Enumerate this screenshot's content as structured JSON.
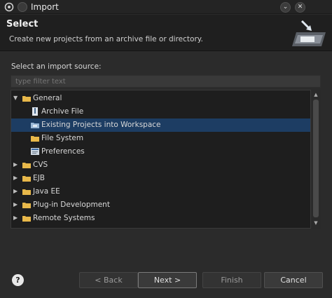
{
  "window": {
    "title": "Import",
    "minimize_glyph": "⌄",
    "close_glyph": "✕"
  },
  "header": {
    "title": "Select",
    "description": "Create new projects from an archive file or directory."
  },
  "source": {
    "label": "Select an import source:",
    "filter_placeholder": "type filter text"
  },
  "tree": {
    "expanded_glyph": "▼",
    "collapsed_glyph": "▶",
    "items": [
      {
        "label": "General",
        "level": 0,
        "expanded": true,
        "icon": "folder-icon"
      },
      {
        "label": "Archive File",
        "level": 1,
        "icon": "archive-file-icon"
      },
      {
        "label": "Existing Projects into Workspace",
        "level": 1,
        "selected": true,
        "icon": "projects-icon"
      },
      {
        "label": "File System",
        "level": 1,
        "icon": "folder-icon"
      },
      {
        "label": "Preferences",
        "level": 1,
        "icon": "preferences-icon"
      },
      {
        "label": "CVS",
        "level": 0,
        "expanded": false,
        "icon": "folder-icon"
      },
      {
        "label": "EJB",
        "level": 0,
        "expanded": false,
        "icon": "folder-icon"
      },
      {
        "label": "Java EE",
        "level": 0,
        "expanded": false,
        "icon": "folder-icon"
      },
      {
        "label": "Plug-in Development",
        "level": 0,
        "expanded": false,
        "icon": "folder-icon"
      },
      {
        "label": "Remote Systems",
        "level": 0,
        "expanded": false,
        "icon": "folder-icon"
      }
    ]
  },
  "buttons": {
    "help": "?",
    "back": "< Back",
    "next": "Next >",
    "finish": "Finish",
    "cancel": "Cancel"
  },
  "colors": {
    "selection": "#1d3d63",
    "folder": "#e8b84a",
    "background": "#2b2b2b"
  }
}
